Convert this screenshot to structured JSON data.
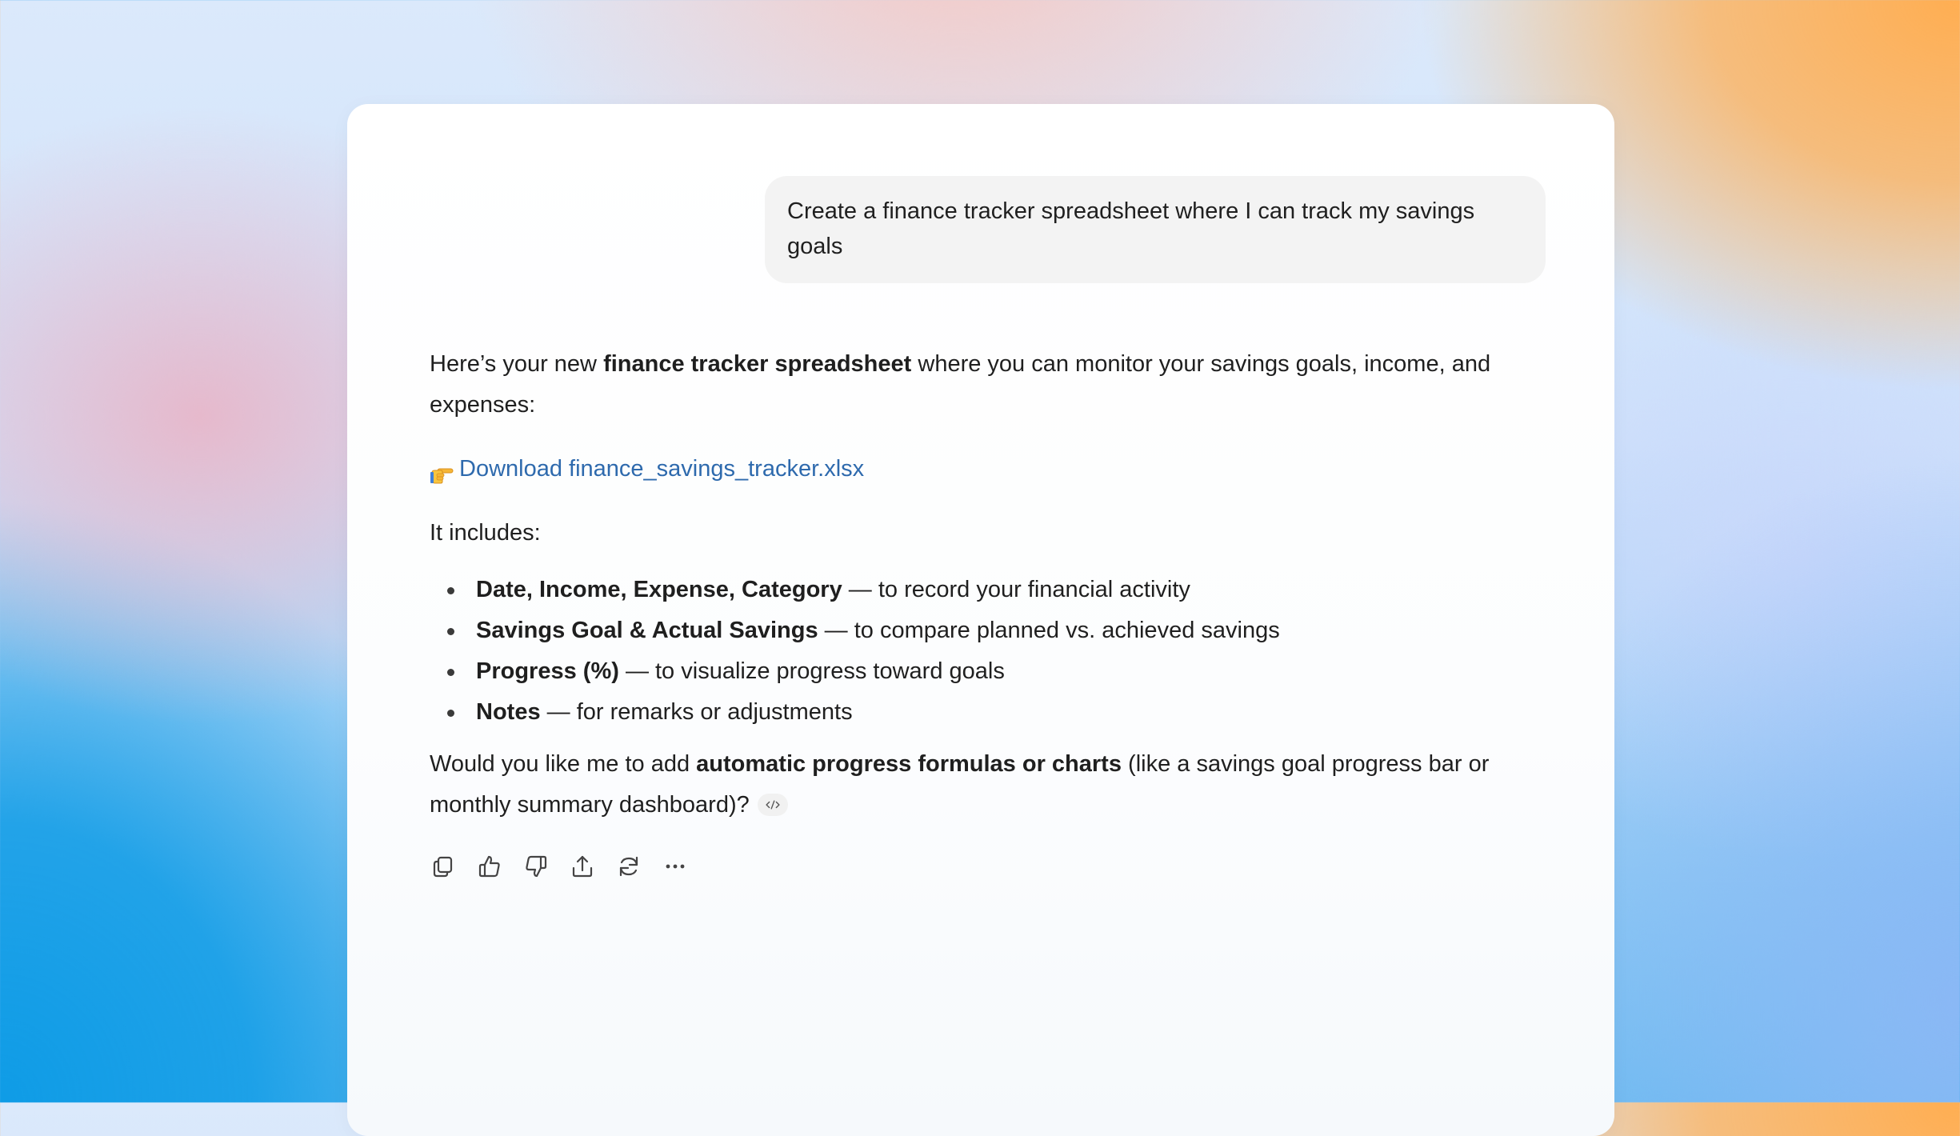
{
  "conversation": {
    "user_message": "Create a finance tracker spreadsheet where I can track my savings goals",
    "assistant": {
      "intro_before": "Here’s your new ",
      "intro_bold": "finance tracker spreadsheet",
      "intro_after": " where you can monitor your savings goals, income, and expenses:",
      "download_icon": "pointing-hand-icon",
      "download_label": "Download finance_savings_tracker.xlsx",
      "includes_label": "It includes:",
      "features": [
        {
          "bold": "Date, Income, Expense, Category",
          "text": " — to record your financial activity"
        },
        {
          "bold": "Savings Goal & Actual Savings",
          "text": " — to compare planned vs. achieved savings"
        },
        {
          "bold": "Progress (%)",
          "text": " — to visualize progress toward goals"
        },
        {
          "bold": "Notes",
          "text": " — for remarks or adjustments"
        }
      ],
      "followup_before": "Would you like me to add ",
      "followup_bold": "automatic progress formulas or charts",
      "followup_after": " (like a savings goal progress bar or monthly summary dashboard)?",
      "code_badge_icon": "code-icon"
    }
  },
  "actions": [
    {
      "name": "copy",
      "icon": "copy-icon"
    },
    {
      "name": "thumbs-up",
      "icon": "thumbs-up-icon"
    },
    {
      "name": "thumbs-down",
      "icon": "thumbs-down-icon"
    },
    {
      "name": "share",
      "icon": "share-icon"
    },
    {
      "name": "regenerate",
      "icon": "refresh-icon"
    },
    {
      "name": "more",
      "icon": "more-icon"
    }
  ],
  "colors": {
    "link": "#2e6aad",
    "user_bubble": "#f3f3f3",
    "text": "#1f1f1f"
  }
}
